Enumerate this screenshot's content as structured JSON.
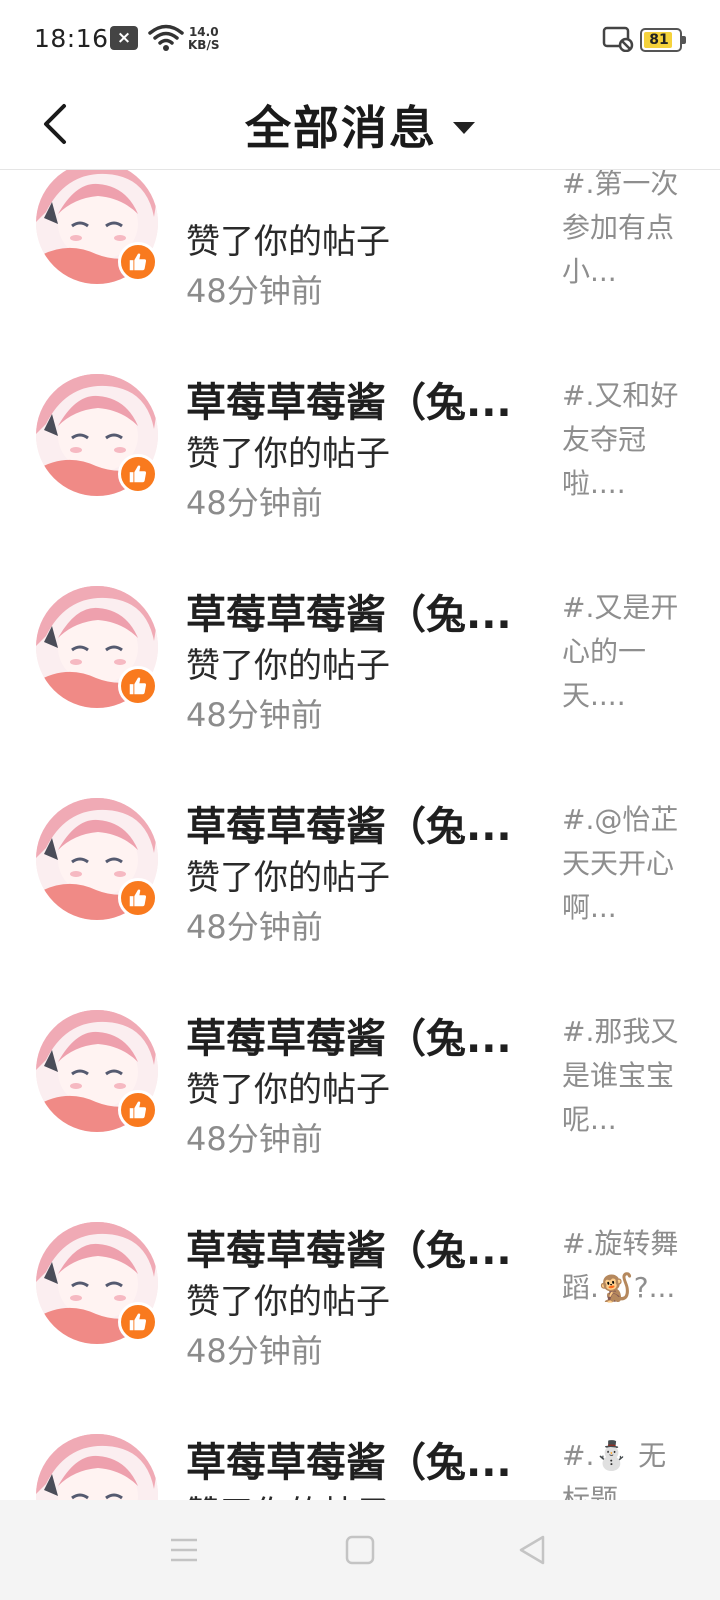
{
  "status_bar": {
    "time": "18:16",
    "notification_icon": "close-box-icon",
    "wifi_icon": "wifi-icon",
    "speed_value": "14.0",
    "speed_unit": "KB/S",
    "cast_icon": "cast-off-icon",
    "battery_level": "81",
    "battery_color": "#f5d23b"
  },
  "header": {
    "back_icon": "chevron-left-icon",
    "title": "全部消息",
    "dropdown_icon": "caret-down-icon"
  },
  "messages": {
    "accent_color": "#f97a1e",
    "items": [
      {
        "name": "",
        "action": "赞了你的帖子",
        "time": "48分钟前",
        "preview": "#.第一次参加有点小..."
      },
      {
        "name": "草莓草莓酱（兔...",
        "action": "赞了你的帖子",
        "time": "48分钟前",
        "preview": "#.又和好友夺冠啦...."
      },
      {
        "name": "草莓草莓酱（兔...",
        "action": "赞了你的帖子",
        "time": "48分钟前",
        "preview": "#.又是开心的一天...."
      },
      {
        "name": "草莓草莓酱（兔...",
        "action": "赞了你的帖子",
        "time": "48分钟前",
        "preview": "#.@怡芷天天开心啊..."
      },
      {
        "name": "草莓草莓酱（兔...",
        "action": "赞了你的帖子",
        "time": "48分钟前",
        "preview": "#.那我又是谁宝宝呢..."
      },
      {
        "name": "草莓草莓酱（兔...",
        "action": "赞了你的帖子",
        "time": "48分钟前",
        "preview": "#.旋转舞蹈.🐒?..."
      },
      {
        "name": "草莓草莓酱（兔...",
        "action": "赞了你的帖子",
        "time": "",
        "preview": "#.⛄ 无标题"
      }
    ]
  },
  "nav_bar": {
    "menu_icon": "menu-icon",
    "home_icon": "home-square-icon",
    "back_icon": "back-triangle-icon"
  }
}
